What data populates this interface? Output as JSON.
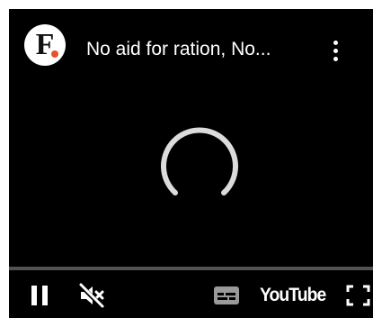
{
  "channel": {
    "logo_letter": "F",
    "logo_icon": "firstpost-logo-icon",
    "accent_color": "#e8522b"
  },
  "video": {
    "title": "No aid for ration, No..."
  },
  "overlay": {
    "more_icon": "more-vert-icon",
    "loading_icon": "loading-spinner-icon"
  },
  "controls": {
    "pause_icon": "pause-icon",
    "mute_icon": "volume-muted-icon",
    "captions_icon": "captions-icon",
    "youtube_label": "YouTube",
    "fullscreen_icon": "fullscreen-icon"
  },
  "progress": {
    "played_fraction": 0.0,
    "played_color": "#ff0000"
  }
}
